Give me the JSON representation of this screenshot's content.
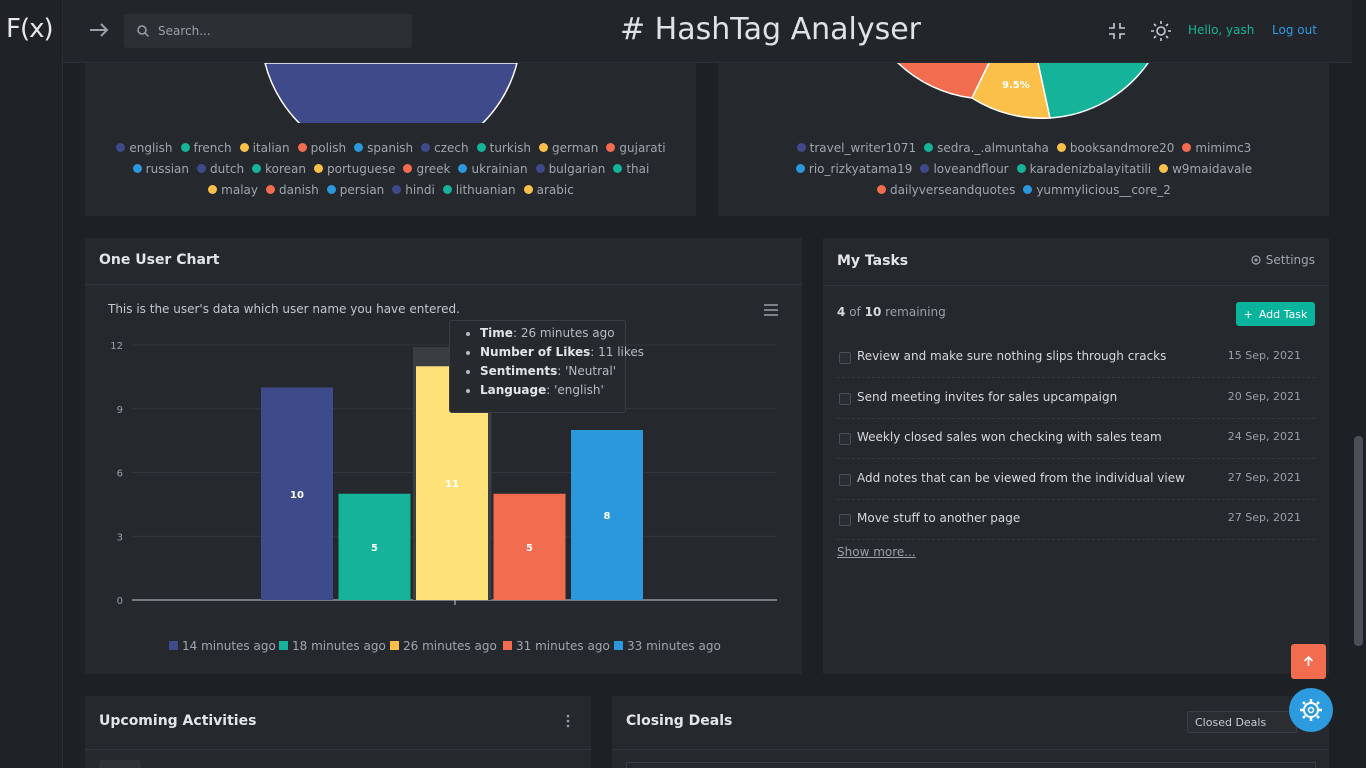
{
  "app": {
    "logo": "F(x)",
    "title": "# HashTag Analyser"
  },
  "topbar": {
    "search_placeholder": "Search...",
    "greeting": "Hello, yash",
    "logout": "Log out"
  },
  "colors": {
    "accent_green": "#19b394",
    "accent_blue": "#2d9be0",
    "navy": "#3f4a8a",
    "teal": "#14b39a",
    "yellow": "#fbc04a",
    "orange": "#f26c4f",
    "sky": "#2b98dc",
    "highlight_yellow": "#fde27a"
  },
  "top_left_legend": [
    {
      "label": "english",
      "color": "#3f4a8a"
    },
    {
      "label": "french",
      "color": "#14b39a"
    },
    {
      "label": "italian",
      "color": "#fbc04a"
    },
    {
      "label": "polish",
      "color": "#f26c4f"
    },
    {
      "label": "spanish",
      "color": "#2b98dc"
    },
    {
      "label": "czech",
      "color": "#3f4a8a"
    },
    {
      "label": "turkish",
      "color": "#14b39a"
    },
    {
      "label": "german",
      "color": "#fbc04a"
    },
    {
      "label": "gujarati",
      "color": "#f26c4f"
    },
    {
      "label": "russian",
      "color": "#2b98dc"
    },
    {
      "label": "dutch",
      "color": "#3f4a8a"
    },
    {
      "label": "korean",
      "color": "#14b39a"
    },
    {
      "label": "portuguese",
      "color": "#fbc04a"
    },
    {
      "label": "greek",
      "color": "#f26c4f"
    },
    {
      "label": "ukrainian",
      "color": "#2b98dc"
    },
    {
      "label": "bulgarian",
      "color": "#3f4a8a"
    },
    {
      "label": "thai",
      "color": "#14b39a"
    },
    {
      "label": "malay",
      "color": "#fbc04a"
    },
    {
      "label": "danish",
      "color": "#f26c4f"
    },
    {
      "label": "persian",
      "color": "#2b98dc"
    },
    {
      "label": "hindi",
      "color": "#3f4a8a"
    },
    {
      "label": "lithuanian",
      "color": "#14b39a"
    },
    {
      "label": "arabic",
      "color": "#fbc04a"
    }
  ],
  "top_right_pie_label": "9.5%",
  "top_right_legend": [
    {
      "label": "travel_writer1071",
      "color": "#3f4a8a"
    },
    {
      "label": "sedra._.almuntaha",
      "color": "#14b39a"
    },
    {
      "label": "booksandmore20",
      "color": "#fbc04a"
    },
    {
      "label": "mimimc3",
      "color": "#f26c4f"
    },
    {
      "label": "rio_rizkyatama19",
      "color": "#2b98dc"
    },
    {
      "label": "loveandflour",
      "color": "#3f4a8a"
    },
    {
      "label": "karadenizbalayitatili",
      "color": "#14b39a"
    },
    {
      "label": "w9maidavale",
      "color": "#fbc04a"
    },
    {
      "label": "dailyverseandquotes",
      "color": "#f26c4f"
    },
    {
      "label": "yummylicious__core_2",
      "color": "#2b98dc"
    }
  ],
  "user_chart": {
    "title": "One User Chart",
    "subtitle": "This is the user's data which user name you have entered.",
    "tooltip": {
      "time_label": "Time",
      "time": "26 minutes ago",
      "likes_label": "Number of Likes",
      "likes": "11 likes",
      "sent_label": "Sentiments",
      "sent": "'Neutral'",
      "lang_label": "Language",
      "lang": "'english'"
    }
  },
  "chart_data": {
    "type": "bar",
    "categories": [
      "14 minutes ago",
      "18 minutes ago",
      "26 minutes ago",
      "31 minutes ago",
      "33 minutes ago"
    ],
    "values": [
      10,
      5,
      11,
      5,
      8
    ],
    "colors": [
      "#3f4a8a",
      "#14b39a",
      "#fde27a",
      "#f26c4f",
      "#2b98dc"
    ],
    "legend_colors": [
      "#3f4a8a",
      "#14b39a",
      "#fbc04a",
      "#f26c4f",
      "#2b98dc"
    ],
    "yticks": [
      0,
      3,
      6,
      9,
      12
    ],
    "ylim": [
      0,
      12
    ],
    "highlighted_index": 2,
    "legend_position": "bottom"
  },
  "tasks": {
    "title": "My Tasks",
    "settings": "Settings",
    "remaining_count": "4",
    "remaining_of": "of",
    "remaining_total": "10",
    "remaining_label": "remaining",
    "add_label": "Add Task",
    "items": [
      {
        "text": "Review and make sure nothing slips through cracks",
        "date": "15 Sep, 2021"
      },
      {
        "text": "Send meeting invites for sales upcampaign",
        "date": "20 Sep, 2021"
      },
      {
        "text": "Weekly closed sales won checking with sales team",
        "date": "24 Sep, 2021"
      },
      {
        "text": "Add notes that can be viewed from the individual view",
        "date": "27 Sep, 2021"
      },
      {
        "text": "Move stuff to another page",
        "date": "27 Sep, 2021"
      }
    ],
    "show_more": "Show more..."
  },
  "activities": {
    "title": "Upcoming Activities"
  },
  "deals": {
    "title": "Closing Deals",
    "select": "Closed Deals"
  }
}
